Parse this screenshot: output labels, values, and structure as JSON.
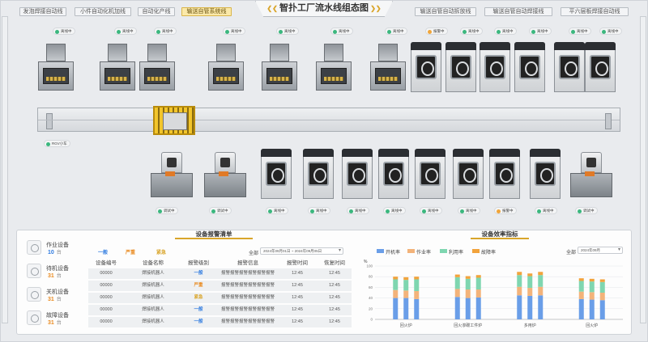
{
  "header": {
    "title": "智扑工厂流水线组态图",
    "left_tabs": [
      "发泡焊接自动线",
      "小件自动化机加线",
      "自动化产线",
      "输送自管系统线"
    ],
    "active_tab_index": 3,
    "right_tabs": [
      "输送自管自动拆放线",
      "输送自管自动焊接线",
      "平六层板焊接自动线"
    ]
  },
  "machines": {
    "top_row_status": [
      "离线中",
      "离线中",
      "离线中",
      "离线中",
      "离线中",
      "离线中",
      "离线中",
      "报警中",
      "离线中",
      "离线中",
      "离线中",
      "离线中",
      "离线中"
    ],
    "top_row_warn_index": 7,
    "conveyor_label": "RGV小车",
    "bottom_row_status": [
      "调试中",
      "调试中",
      "离线中",
      "离线中",
      "离线中",
      "离线中",
      "离线中",
      "离线中",
      "报警中",
      "离线中",
      "调试中"
    ],
    "bottom_row_warn_index": 8
  },
  "stats": [
    {
      "label": "作业设备",
      "value": "10",
      "unit": "台",
      "color": "#2f7be0"
    },
    {
      "label": "待机设备",
      "value": "31",
      "unit": "台",
      "color": "#e98a1f"
    },
    {
      "label": "关机设备",
      "value": "31",
      "unit": "台",
      "color": "#e98a1f"
    },
    {
      "label": "故障设备",
      "value": "31",
      "unit": "台",
      "color": "#e98a1f"
    }
  ],
  "alarm_panel": {
    "title": "设备报警清单",
    "levels": [
      {
        "label": "一般",
        "color": "#2f7be0"
      },
      {
        "label": "严重",
        "color": "#e98a1f"
      },
      {
        "label": "紧急",
        "color": "#d9a52a"
      }
    ],
    "filter_label": "全部",
    "date_range": "2024年09月01日 ~ 2024年09月05日",
    "columns": [
      "设备编号",
      "设备名称",
      "报警级别",
      "报警信息",
      "报警时间",
      "恢复时间"
    ],
    "rows": [
      {
        "id": "00000",
        "name": "焊接机器人",
        "level": "一般",
        "level_class": "badge-blue",
        "info": "报警报警报警报警报警报警",
        "time": "12:45",
        "recover": "12:45"
      },
      {
        "id": "00000",
        "name": "焊接机器人",
        "level": "严重",
        "level_class": "badge-orange",
        "info": "报警报警报警报警报警报警",
        "time": "12:45",
        "recover": "12:45"
      },
      {
        "id": "00000",
        "name": "焊接机器人",
        "level": "紧急",
        "level_class": "badge-yellow",
        "info": "报警报警报警报警报警报警",
        "time": "12:45",
        "recover": "12:45"
      },
      {
        "id": "00000",
        "name": "焊接机器人",
        "level": "一般",
        "level_class": "badge-blue",
        "info": "报警报警报警报警报警报警",
        "time": "12:45",
        "recover": "12:45"
      },
      {
        "id": "00000",
        "name": "焊接机器人",
        "level": "一般",
        "level_class": "badge-blue",
        "info": "报警报警报警报警报警报警",
        "time": "12:45",
        "recover": "12:45"
      }
    ]
  },
  "efficiency_panel": {
    "title": "设备效率指标",
    "filter_label": "全部",
    "date": "2024年09月",
    "y_unit": "%"
  },
  "chart_data": {
    "type": "bar",
    "stacked": true,
    "series": [
      {
        "name": "开机率",
        "color": "#6a9ee8"
      },
      {
        "name": "作业率",
        "color": "#f3b37a"
      },
      {
        "name": "利用率",
        "color": "#7fd6b0"
      },
      {
        "name": "故障率",
        "color": "#f2a33c"
      }
    ],
    "groups": [
      {
        "label": "回火炉",
        "bars": [
          [
            40,
            15,
            20,
            5
          ],
          [
            40,
            14,
            20,
            5
          ],
          [
            38,
            15,
            22,
            5
          ]
        ]
      },
      {
        "label": "回火渗碳工件炉",
        "bars": [
          [
            42,
            15,
            22,
            5
          ],
          [
            40,
            16,
            20,
            5
          ],
          [
            41,
            15,
            22,
            5
          ]
        ]
      },
      {
        "label": "多用炉",
        "bars": [
          [
            45,
            16,
            22,
            6
          ],
          [
            44,
            15,
            22,
            5
          ],
          [
            45,
            16,
            22,
            6
          ]
        ]
      },
      {
        "label": "回火炉",
        "bars": [
          [
            38,
            14,
            20,
            5
          ],
          [
            37,
            14,
            20,
            5
          ],
          [
            36,
            14,
            20,
            5
          ]
        ]
      }
    ],
    "ylim": [
      0,
      100
    ],
    "yticks": [
      0,
      20,
      40,
      60,
      80,
      100
    ]
  }
}
